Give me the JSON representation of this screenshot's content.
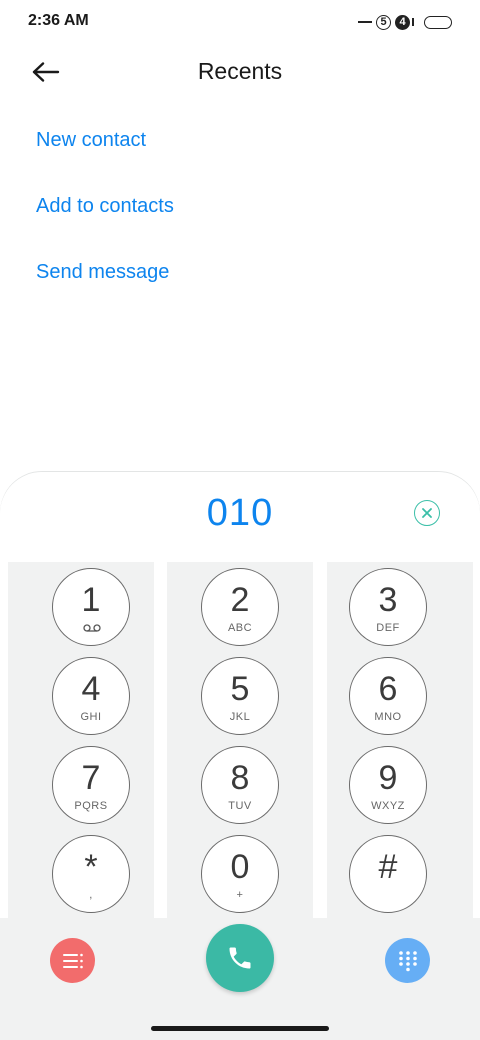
{
  "status_bar": {
    "time": "2:36 AM",
    "sim1": "5",
    "sim2": "4"
  },
  "header": {
    "title": "Recents",
    "back_icon": "arrow-left-icon"
  },
  "actions": [
    {
      "label": "New contact"
    },
    {
      "label": "Add to contacts"
    },
    {
      "label": "Send message"
    }
  ],
  "dialer": {
    "number": "010",
    "clear_icon": "clear-circle-icon",
    "keys": [
      {
        "digit": "1",
        "letters": ""
      },
      {
        "digit": "2",
        "letters": "ABC"
      },
      {
        "digit": "3",
        "letters": "DEF"
      },
      {
        "digit": "4",
        "letters": "GHI"
      },
      {
        "digit": "5",
        "letters": "JKL"
      },
      {
        "digit": "6",
        "letters": "MNO"
      },
      {
        "digit": "7",
        "letters": "PQRS"
      },
      {
        "digit": "8",
        "letters": "TUV"
      },
      {
        "digit": "9",
        "letters": "WXYZ"
      },
      {
        "digit": "*",
        "letters": ","
      },
      {
        "digit": "0",
        "letters": "+"
      },
      {
        "digit": "#",
        "letters": ""
      }
    ],
    "bottom_icons": [
      "menu-icon",
      "phone-icon",
      "dialpad-icon"
    ]
  },
  "colors": {
    "accent": "#0d84ee",
    "call": "#3bb9a5",
    "menu": "#f26c6c",
    "dialpad": "#66aef5"
  }
}
